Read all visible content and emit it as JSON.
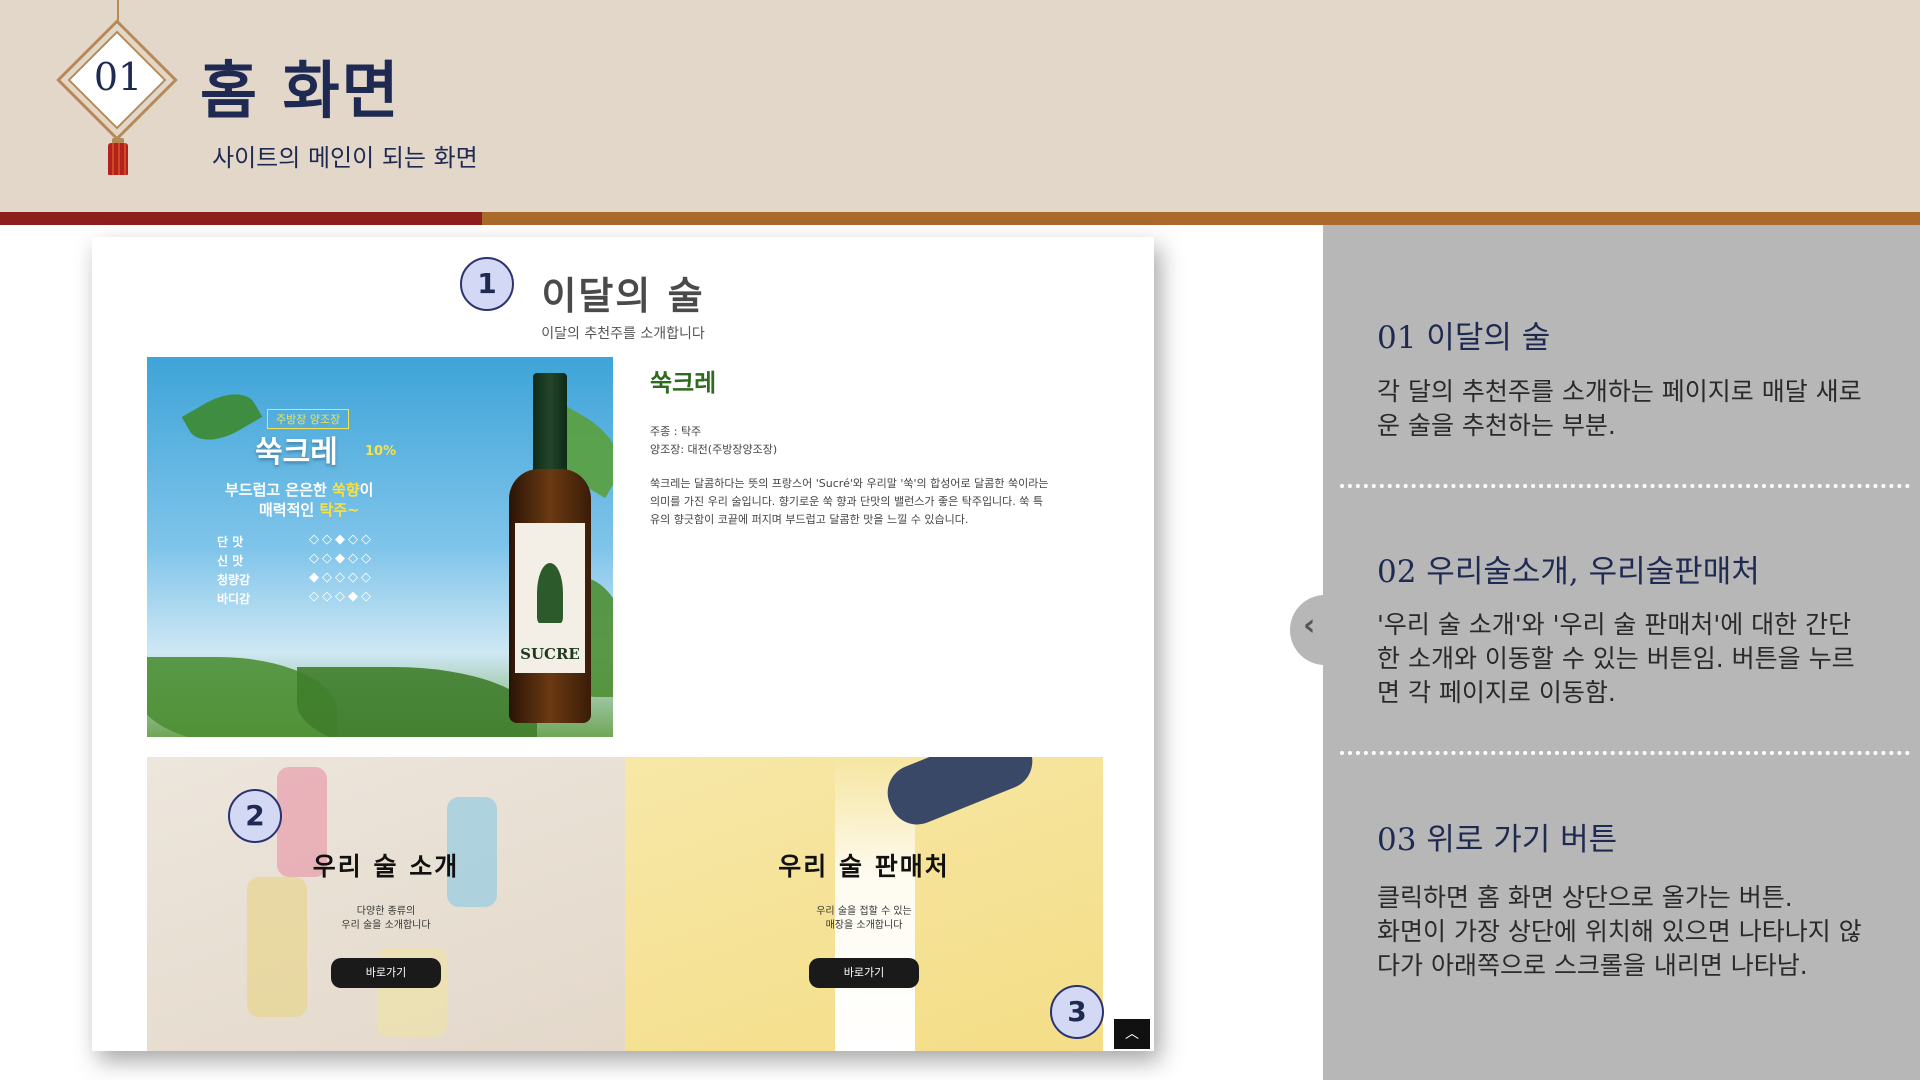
{
  "header": {
    "number": "01",
    "title": "홈 화면",
    "subtitle": "사이트의 메인이 되는 화면"
  },
  "colors": {
    "header_bg": "#e3d7ca",
    "navy": "#1f2a52",
    "bar_red": "#8c1f1c",
    "bar_brown": "#a96a2c",
    "panel_gray": "#b7b7b7"
  },
  "mockup": {
    "section_title": "이달의 술",
    "section_sub": "이달의 추천주를 소개합니다",
    "product_image": {
      "badge": "주방장 양조장",
      "name": "쑥크레",
      "percent": "10%",
      "copy_line1_pre": "부드럽고 은은한 ",
      "copy_line1_hl": "쑥향",
      "copy_line1_post": "이",
      "copy_line2_pre": "매력적인 ",
      "copy_line2_hl": "탁주~",
      "taste_labels": [
        "단  맛",
        "신  맛",
        "청량감",
        "바디감"
      ],
      "bottle_label": "SUCRE"
    },
    "drink_name": "쑥크레",
    "drink_type": "주종 : 탁주",
    "drink_brewery": "양조장: 대전(주방장양조장)",
    "drink_desc": "쑥크레는 달콤하다는 뜻의 프랑스어 'Sucré'와 우리말 '쑥'의 합성어로 달콤한 쑥이라는 의미를 가진 우리 술입니다. 향기로운 쑥 향과 단맛의 밸런스가 좋은 탁주입니다. 쑥 특유의 향긋함이 코끝에 퍼지며 부드럽고 달콤한 맛을 느낄 수 있습니다.",
    "card_left": {
      "title": "우리 술 소개",
      "desc_line1": "다양한 종류의",
      "desc_line2": "우리 술을 소개합니다",
      "button": "바로가기"
    },
    "card_right": {
      "title": "우리 술 판매처",
      "desc_line1": "우리 술을 접할 수 있는",
      "desc_line2": "매장을 소개합니다",
      "button": "바로가기"
    },
    "top_button_icon": "chevron-up-icon",
    "top_button_glyph": "︿",
    "markers": [
      "1",
      "2",
      "3"
    ]
  },
  "panel": {
    "collapse_icon": "chevron-left-icon",
    "collapse_glyph": "‹",
    "sections": [
      {
        "title": "01 이달의 술",
        "line1": "각 달의 추천주를 소개하는 페이지로 매달 새로",
        "line2": "운 술을 추천하는 부분."
      },
      {
        "title": "02 우리술소개, 우리술판매처",
        "line1": "'우리 술 소개'와 '우리 술 판매처'에 대한 간단",
        "line2": "한 소개와 이동할 수 있는 버튼임. 버튼을 누르",
        "line3": "면 각 페이지로 이동함."
      },
      {
        "title": "03 위로 가기 버튼",
        "line1": "클릭하면 홈 화면 상단으로 올가는 버튼.",
        "line2": "화면이 가장 상단에 위치해 있으면 나타나지 않",
        "line3": "다가 아래쪽으로 스크롤을 내리면 나타남."
      }
    ]
  }
}
